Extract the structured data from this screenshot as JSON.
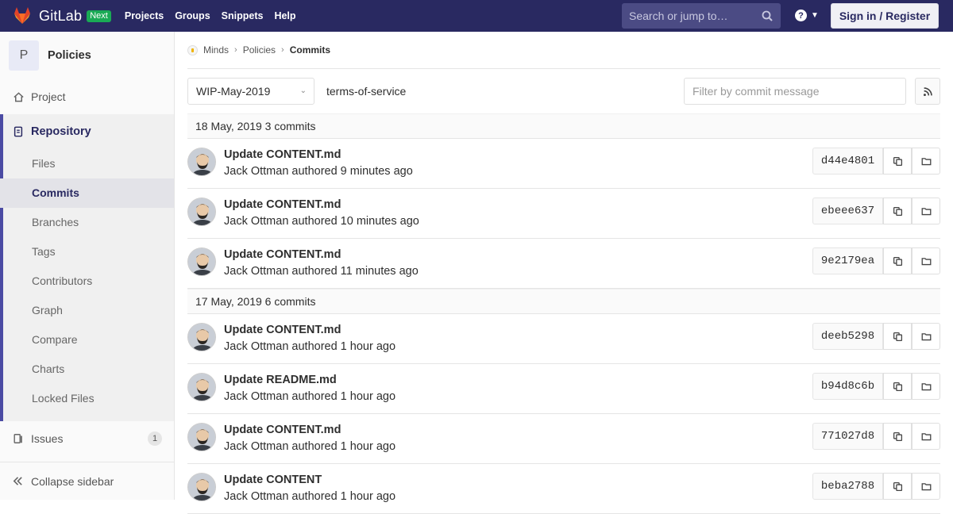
{
  "topbar": {
    "brand": "GitLab",
    "badge": "Next",
    "nav": [
      "Projects",
      "Groups",
      "Snippets",
      "Help"
    ],
    "search_placeholder": "Search or jump to…",
    "help_symbol": "?",
    "signin": "Sign in / Register",
    "colors": {
      "bar": "#292961",
      "badge": "#1aaa55"
    }
  },
  "sidebar": {
    "project_letter": "P",
    "project_name": "Policies",
    "project_link": "Project",
    "repository": "Repository",
    "repo_items": [
      "Files",
      "Commits",
      "Branches",
      "Tags",
      "Contributors",
      "Graph",
      "Compare",
      "Charts",
      "Locked Files"
    ],
    "active_item": "Commits",
    "issues": "Issues",
    "issues_count": "1",
    "collapse": "Collapse sidebar"
  },
  "breadcrumb": {
    "items": [
      "Minds",
      "Policies",
      "Commits"
    ]
  },
  "toolbar": {
    "branch": "WIP-May-2019",
    "path": "terms-of-service",
    "filter_placeholder": "Filter by commit message"
  },
  "days": [
    {
      "date": "18 May, 2019 3 commits",
      "commits": [
        {
          "title": "Update CONTENT.md",
          "meta": "Jack Ottman authored 9 minutes ago",
          "sha": "d44e4801"
        },
        {
          "title": "Update CONTENT.md",
          "meta": "Jack Ottman authored 10 minutes ago",
          "sha": "ebeee637"
        },
        {
          "title": "Update CONTENT.md",
          "meta": "Jack Ottman authored 11 minutes ago",
          "sha": "9e2179ea"
        }
      ]
    },
    {
      "date": "17 May, 2019 6 commits",
      "commits": [
        {
          "title": "Update CONTENT.md",
          "meta": "Jack Ottman authored 1 hour ago",
          "sha": "deeb5298"
        },
        {
          "title": "Update README.md",
          "meta": "Jack Ottman authored 1 hour ago",
          "sha": "b94d8c6b"
        },
        {
          "title": "Update CONTENT.md",
          "meta": "Jack Ottman authored 1 hour ago",
          "sha": "771027d8"
        },
        {
          "title": "Update CONTENT",
          "meta": "Jack Ottman authored 1 hour ago",
          "sha": "beba2788"
        }
      ]
    }
  ],
  "icons": [
    "gitlab-logo-icon",
    "search-icon",
    "help-icon",
    "home-icon",
    "repository-icon",
    "issues-icon",
    "collapse-icon",
    "rss-icon",
    "copy-icon",
    "folder-icon",
    "avatar"
  ]
}
